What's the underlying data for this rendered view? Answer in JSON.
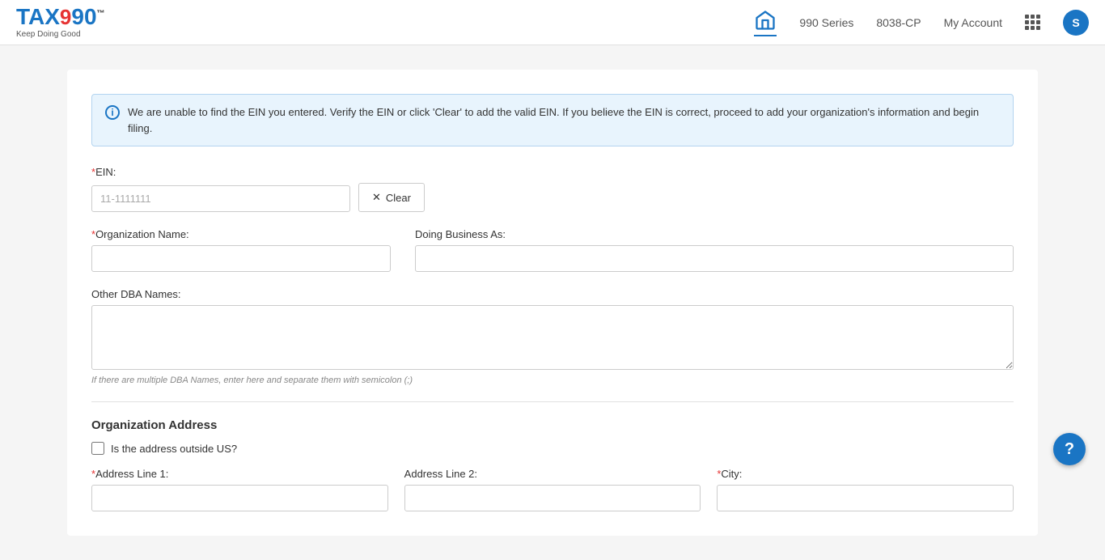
{
  "header": {
    "logo_tax": "TAX",
    "logo_990": "990",
    "logo_tm": "™",
    "tagline": "Keep Doing Good",
    "nav": {
      "series_990": "990 Series",
      "series_8038": "8038-CP",
      "my_account": "My Account",
      "avatar_initial": "S"
    }
  },
  "alert": {
    "message": "We are unable to find the EIN you entered. Verify the EIN or click 'Clear' to add the valid EIN. If you believe the EIN is correct, proceed to add your organization's information and begin filing."
  },
  "form": {
    "ein_label": "EIN:",
    "ein_value": "11-1111111",
    "clear_button": "Clear",
    "org_name_label": "Organization Name:",
    "dba_label": "Doing Business As:",
    "other_dba_label": "Other DBA Names:",
    "dba_hint": "If there are multiple DBA Names, enter here and separate them with semicolon (;)",
    "org_address_title": "Organization Address",
    "outside_us_label": "Is the address outside US?",
    "address_line1_label": "Address Line 1:",
    "address_line2_label": "Address Line 2:",
    "city_label": "City:"
  },
  "icons": {
    "info": "i",
    "close": "✕",
    "help": "?"
  }
}
